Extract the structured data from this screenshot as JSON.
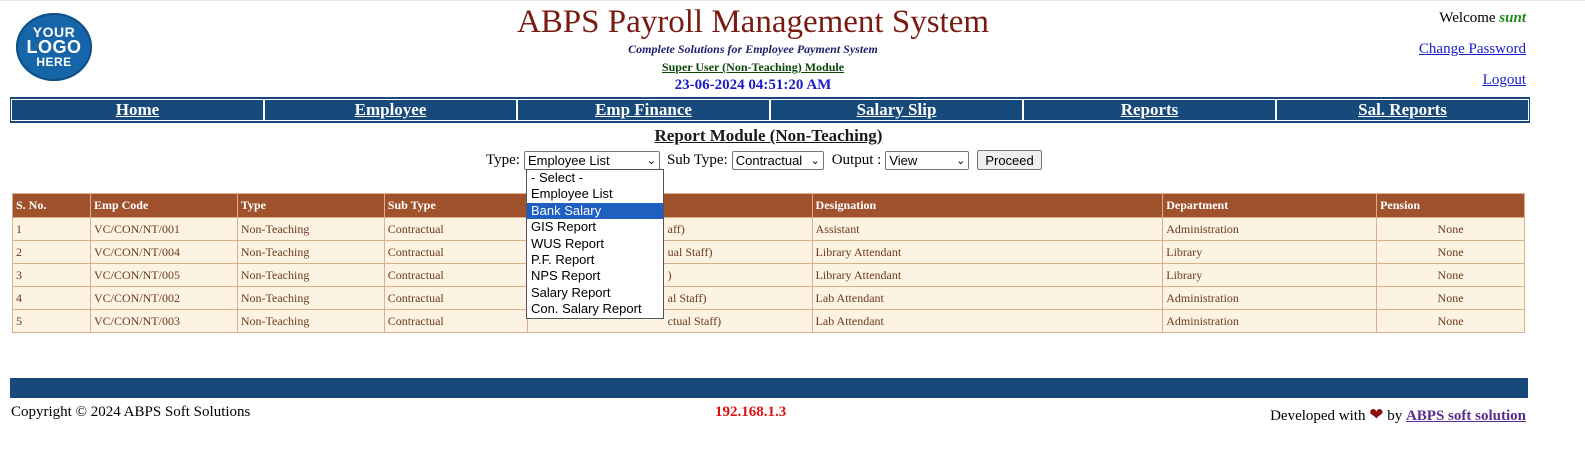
{
  "header": {
    "logo_lines": [
      "YOUR",
      "LOGO",
      "HERE"
    ],
    "title": "ABPS Payroll Management System",
    "tagline": "Complete Solutions for Employee Payment System",
    "module": "Super User (Non-Teaching) Module",
    "datetime": "23-06-2024 04:51:20 AM",
    "welcome": "Welcome",
    "username": "sunt",
    "change_password": "Change Password",
    "logout": "Logout"
  },
  "nav": [
    "Home",
    "Employee",
    "Emp Finance",
    "Salary Slip",
    "Reports",
    "Sal. Reports"
  ],
  "page": {
    "heading": "Report Module (Non-Teaching)",
    "type_label": "Type:",
    "type_value": "Employee List",
    "subtype_label": "Sub Type:",
    "subtype_value": "Contractual",
    "output_label": "Output :",
    "output_value": "View",
    "proceed": "Proceed"
  },
  "type_options": [
    "- Select -",
    "Employee List",
    "Bank Salary",
    "GIS Report",
    "WUS Report",
    "P.F. Report",
    "NPS Report",
    "Salary Report",
    "Con. Salary Report"
  ],
  "type_highlighted_index": 2,
  "table": {
    "headers": [
      "S. No.",
      "Emp Code",
      "Type",
      "Sub Type",
      "",
      "Designation",
      "Department",
      "Pension"
    ],
    "rows": [
      [
        "1",
        "VC/CON/NT/001",
        "Non-Teaching",
        "Contractual",
        "aff)",
        "Assistant",
        "Administration",
        "None"
      ],
      [
        "2",
        "VC/CON/NT/004",
        "Non-Teaching",
        "Contractual",
        "ual Staff)",
        "Library Attendant",
        "Library",
        "None"
      ],
      [
        "3",
        "VC/CON/NT/005",
        "Non-Teaching",
        "Contractual",
        ")",
        "Library Attendant",
        "Library",
        "None"
      ],
      [
        "4",
        "VC/CON/NT/002",
        "Non-Teaching",
        "Contractual",
        "al Staff)",
        "Lab Attendant",
        "Administration",
        "None"
      ],
      [
        "5",
        "VC/CON/NT/003",
        "Non-Teaching",
        "Contractual",
        "ctual Staff)",
        "Lab Attendant",
        "Administration",
        "None"
      ]
    ]
  },
  "footer": {
    "copyright": "Copyright © 2024 ABPS Soft Solutions",
    "ip": "192.168.1.3",
    "developed_with": "Developed with",
    "by": "by",
    "company": "ABPS soft solution"
  }
}
